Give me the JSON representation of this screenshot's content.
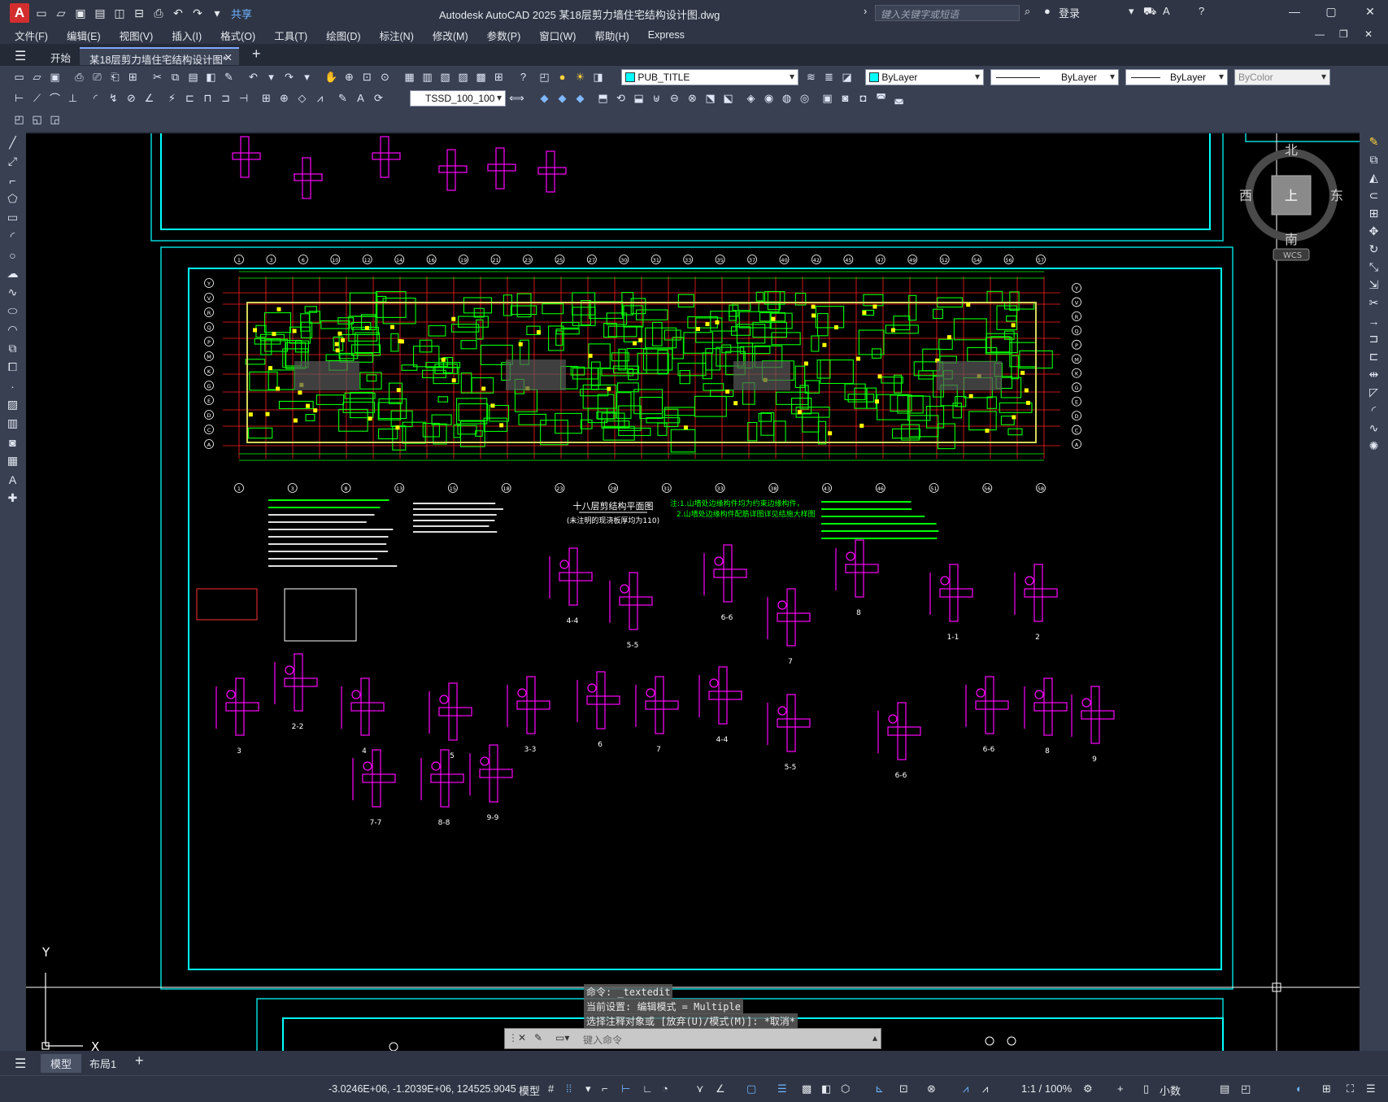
{
  "title_bar": {
    "app_logo": "A",
    "share_label": "共享",
    "window_title": "Autodesk AutoCAD 2025    某18层剪力墙住宅结构设计图.dwg",
    "search_placeholder": "键入关键字或短语",
    "login_label": "登录"
  },
  "menu": {
    "items": [
      "文件(F)",
      "编辑(E)",
      "视图(V)",
      "插入(I)",
      "格式(O)",
      "工具(T)",
      "绘图(D)",
      "标注(N)",
      "修改(M)",
      "参数(P)",
      "窗口(W)",
      "帮助(H)",
      "Express"
    ]
  },
  "file_tabs": {
    "start_label": "开始",
    "active_label": "某18层剪力墙住宅结构设计图*"
  },
  "properties": {
    "layer": "PUB_TITLE",
    "color": "ByLayer",
    "linetype": "ByLayer",
    "lineweight": "ByLayer",
    "plotstyle": "ByColor",
    "dimstyle": "TSSD_100_100"
  },
  "viewcube": {
    "north": "北",
    "south": "南",
    "west": "西",
    "east": "东",
    "top": "上",
    "wcs": "WCS"
  },
  "drawing": {
    "plan_title": "十八层剪结构平面图",
    "plan_subtitle": "(未注明的现浇板厚均为110)",
    "note_title": "注:1.山墙处边缘构件均为约束边缘构件，",
    "note_line2": "2.山墙处边缘构件配筋详图详见结施大样图",
    "axes_top": [
      "1",
      "3",
      "6",
      "10",
      "12",
      "14",
      "16",
      "19",
      "21",
      "23",
      "25",
      "27",
      "30",
      "31",
      "33",
      "35",
      "37",
      "40",
      "42",
      "45",
      "47",
      "49",
      "52",
      "54",
      "56",
      "57"
    ],
    "axes_bottom": [
      "1",
      "3",
      "8",
      "13",
      "15",
      "18",
      "23",
      "28",
      "31",
      "33",
      "38",
      "43",
      "46",
      "51",
      "56",
      "58"
    ],
    "axes_left": [
      "Y",
      "V",
      "R",
      "Q",
      "P",
      "M",
      "K",
      "G",
      "E",
      "D",
      "C",
      "A"
    ],
    "section_labels": [
      "4-4",
      "5-5",
      "6-6",
      "7",
      "8",
      "1-1",
      "2",
      "3",
      "2-2",
      "4",
      "5",
      "3-3",
      "6",
      "7",
      "4-4",
      "5-5",
      "6-6",
      "6-6",
      "8",
      "9",
      "7-7",
      "8-8",
      "9-9"
    ]
  },
  "command": {
    "history_1": "命令:  _textedit",
    "history_2": "当前设置: 编辑模式 = Multiple",
    "history_3": "选择注释对象或 [放弃(U)/模式(M)]: *取消*",
    "prompt": "键入命令"
  },
  "layout_tabs": {
    "model_label": "模型",
    "layout1_label": "布局1"
  },
  "status": {
    "coordinates": "-3.0246E+06, -1.2039E+06, 124525.9045",
    "model_label": "模型",
    "scale": "1:1 / 100%",
    "units": "小数"
  },
  "colors": {
    "accent": "#7fa8ff",
    "plan_green": "#00ff00",
    "detail_magenta": "#ff00ff",
    "frame_cyan": "#00e5e5",
    "grid_red": "#ff2020"
  }
}
